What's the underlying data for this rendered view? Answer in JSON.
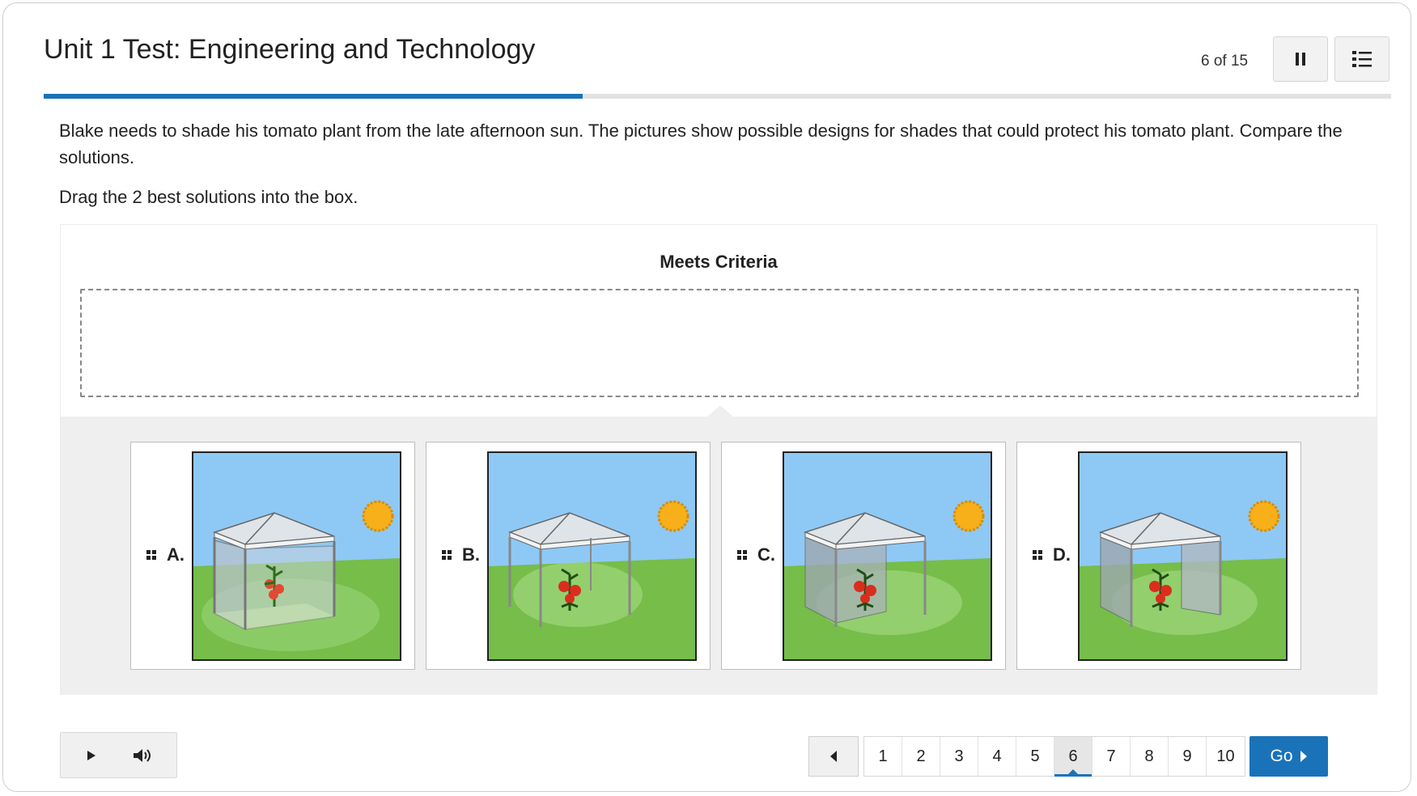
{
  "header": {
    "title": "Unit 1 Test: Engineering and Technology",
    "counter": "6 of 15",
    "pause_icon": "pause-icon",
    "list_icon": "question-list-icon"
  },
  "progress": {
    "fraction": 0.4,
    "color": "#1a73b8"
  },
  "question": {
    "prompt": "Blake needs to shade his tomato plant from the late afternoon sun. The pictures show possible designs for shades that could protect his tomato plant. Compare the solutions.",
    "instruction": "Drag the 2 best solutions into the box."
  },
  "drop_box": {
    "label": "Meets Criteria"
  },
  "choices": [
    {
      "letter": "A.",
      "design": "canopy with four walls"
    },
    {
      "letter": "B.",
      "design": "canopy with no walls"
    },
    {
      "letter": "C.",
      "design": "canopy with back and right walls"
    },
    {
      "letter": "D.",
      "design": "canopy with left and right walls"
    }
  ],
  "audio": {
    "play_icon": "play-icon",
    "volume_icon": "volume-icon"
  },
  "pagination": {
    "pages": [
      "1",
      "2",
      "3",
      "4",
      "5",
      "6",
      "7",
      "8",
      "9",
      "10"
    ],
    "current": "6",
    "go_label": "Go"
  }
}
